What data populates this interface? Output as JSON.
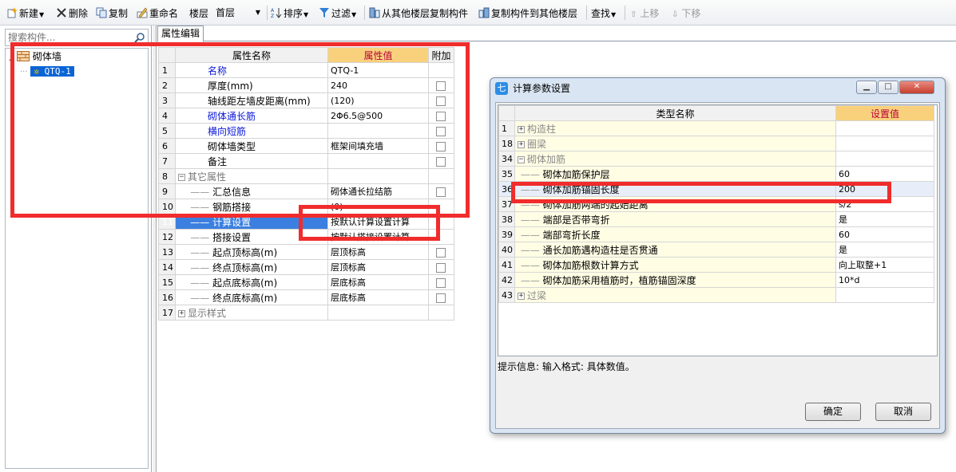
{
  "toolbar": {
    "new_label": "新建",
    "delete_label": "删除",
    "copy_label": "复制",
    "rename_label": "重命名",
    "floor_label": "楼层",
    "floor_value": "首层",
    "sort_label": "排序",
    "filter_label": "过滤",
    "copy_from_floor_label": "从其他楼层复制构件",
    "copy_to_floor_label": "复制构件到其他楼层",
    "find_label": "查找",
    "move_up_label": "上移",
    "move_down_label": "下移"
  },
  "left_panel": {
    "search_placeholder": "搜索构件...",
    "tree": {
      "root_label": "砌体墙",
      "child_label": "QTQ-1"
    }
  },
  "tabs": {
    "property_edit": "属性编辑"
  },
  "property_grid": {
    "headers": {
      "name": "属性名称",
      "value": "属性值",
      "extra": "附加"
    },
    "rows": [
      {
        "num": "1",
        "name": "名称",
        "value": "QTQ-1",
        "checkbox": false
      },
      {
        "num": "2",
        "name": "厚度(mm)",
        "value": "240",
        "checkbox": true
      },
      {
        "num": "3",
        "name": "轴线距左墙皮距离(mm)",
        "value": "(120)",
        "checkbox": true
      },
      {
        "num": "4",
        "name": "砌体通长筋",
        "value": "2Φ6.5@500",
        "checkbox": true
      },
      {
        "num": "5",
        "name": "横向短筋",
        "value": "",
        "checkbox": true
      },
      {
        "num": "6",
        "name": "砌体墙类型",
        "value": "框架间填充墙",
        "checkbox": true
      },
      {
        "num": "7",
        "name": "备注",
        "value": "",
        "checkbox": true
      },
      {
        "num": "8",
        "name": "其它属性",
        "value": "",
        "checkbox": false
      },
      {
        "num": "9",
        "name": "汇总信息",
        "value": "砌体通长拉结筋",
        "checkbox": true
      },
      {
        "num": "10",
        "name": "钢筋搭接",
        "value": "(0)",
        "checkbox": false
      },
      {
        "num": "11",
        "name": "计算设置",
        "value": "按默认计算设置计算",
        "checkbox": false
      },
      {
        "num": "12",
        "name": "搭接设置",
        "value": "按默认搭接设置计算",
        "checkbox": false
      },
      {
        "num": "13",
        "name": "起点顶标高(m)",
        "value": "层顶标高",
        "checkbox": true
      },
      {
        "num": "14",
        "name": "终点顶标高(m)",
        "value": "层顶标高",
        "checkbox": true
      },
      {
        "num": "15",
        "name": "起点底标高(m)",
        "value": "层底标高",
        "checkbox": true
      },
      {
        "num": "16",
        "name": "终点底标高(m)",
        "value": "层底标高",
        "checkbox": true
      },
      {
        "num": "17",
        "name": "显示样式",
        "value": "",
        "checkbox": false
      }
    ]
  },
  "dialog": {
    "title": "计算参数设置",
    "headers": {
      "name": "类型名称",
      "value": "设置值"
    },
    "rows": [
      {
        "num": "1",
        "name": "构造柱",
        "value": ""
      },
      {
        "num": "18",
        "name": "圈梁",
        "value": ""
      },
      {
        "num": "34",
        "name": "砌体加筋",
        "value": ""
      },
      {
        "num": "35",
        "name": "砌体加筋保护层",
        "value": "60"
      },
      {
        "num": "36",
        "name": "砌体加筋锚固长度",
        "value": "200"
      },
      {
        "num": "37",
        "name": "砌体加筋两端的起始距离",
        "value": "s/2"
      },
      {
        "num": "38",
        "name": "端部是否带弯折",
        "value": "是"
      },
      {
        "num": "39",
        "name": "端部弯折长度",
        "value": "60"
      },
      {
        "num": "40",
        "name": "通长加筋遇构造柱是否贯通",
        "value": "是"
      },
      {
        "num": "41",
        "name": "砌体加筋根数计算方式",
        "value": "向上取整+1"
      },
      {
        "num": "42",
        "name": "砌体加筋采用植筋时，植筋锚固深度",
        "value": "10*d"
      },
      {
        "num": "43",
        "name": "过梁",
        "value": ""
      }
    ],
    "hint": "提示信息: 输入格式: 具体数值。",
    "ok_label": "确定",
    "cancel_label": "取消"
  },
  "colors": {
    "value_header_bg": "#f9d17c",
    "value_header_text": "#b8003a",
    "annotation_red": "#f02c2c",
    "selection_blue": "#3b80e0",
    "link_blue": "#0b18d6"
  }
}
